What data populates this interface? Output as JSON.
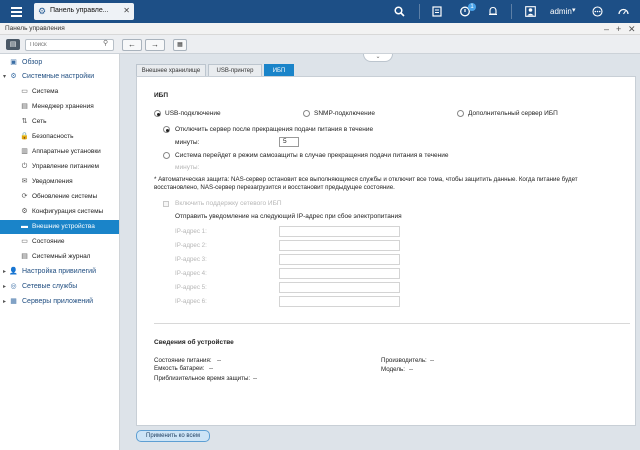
{
  "topbar": {
    "tab_title": "Панель управле...",
    "notification_count": "1",
    "user": "admin"
  },
  "window": {
    "title": "Панель управления"
  },
  "toolbar": {
    "search_placeholder": "Поиск"
  },
  "sidebar": {
    "items": [
      {
        "label": "Обзор",
        "level": 0
      },
      {
        "label": "Системные настройки",
        "level": 0
      },
      {
        "label": "Система",
        "level": 1
      },
      {
        "label": "Менеджер хранения",
        "level": 1
      },
      {
        "label": "Сеть",
        "level": 1
      },
      {
        "label": "Безопасность",
        "level": 1
      },
      {
        "label": "Аппаратные установки",
        "level": 1
      },
      {
        "label": "Управление питанием",
        "level": 1
      },
      {
        "label": "Уведомления",
        "level": 1
      },
      {
        "label": "Обновление системы",
        "level": 1
      },
      {
        "label": "Конфигурация системы",
        "level": 1
      },
      {
        "label": "Внешние устройства",
        "level": 1,
        "active": true
      },
      {
        "label": "Состояние",
        "level": 1
      },
      {
        "label": "Системный журнал",
        "level": 1
      },
      {
        "label": "Настройка привилегий",
        "level": 0
      },
      {
        "label": "Сетевые службы",
        "level": 0
      },
      {
        "label": "Серверы приложений",
        "level": 0
      }
    ]
  },
  "tabs": [
    {
      "label": "Внешнее хранилище"
    },
    {
      "label": "USB-принтер"
    },
    {
      "label": "ИБП",
      "active": true
    }
  ],
  "ups": {
    "section_title": "ИБП",
    "modes": {
      "usb": "USB-подключение",
      "snmp": "SNMP-подключение",
      "extra": "Дополнительный сервер ИБП"
    },
    "option1": "Отключить сервер после прекращения подачи питания в течение",
    "minutes_label": "минуты:",
    "minutes_value": "5",
    "option2": "Система перейдет в режим самозащиты в случае прекращения подачи питания в течение",
    "minutes_label2": "минуты:",
    "note": "* Автоматическая защита: NAS-сервер остановит все выполняющиеся службы и отключит все тома, чтобы защитить данные. Когда питание будет восстановлено, NAS-сервер перезагрузится и восстановит предыдущее состояние.",
    "network_support": "Включить поддержку сетевого ИБП",
    "notify_text": "Отправить уведомление на следующий IP-адрес при сбое электропитания",
    "ip_labels": [
      "IP-адрес 1:",
      "IP-адрес 2:",
      "IP-адрес 3:",
      "IP-адрес 4:",
      "IP-адрес 5:",
      "IP-адрес 6:"
    ]
  },
  "device_info": {
    "title": "Сведения об устройстве",
    "power_status_label": "Состояние питания:",
    "power_status_value": "--",
    "battery_label": "Емкость батареи:",
    "battery_value": "--",
    "runtime_label": "Приблизительное время защиты:",
    "runtime_value": "--",
    "manufacturer_label": "Производитель:",
    "manufacturer_value": "--",
    "model_label": "Модель:",
    "model_value": "--"
  },
  "footer": {
    "apply_all": "Применить ко всем"
  }
}
